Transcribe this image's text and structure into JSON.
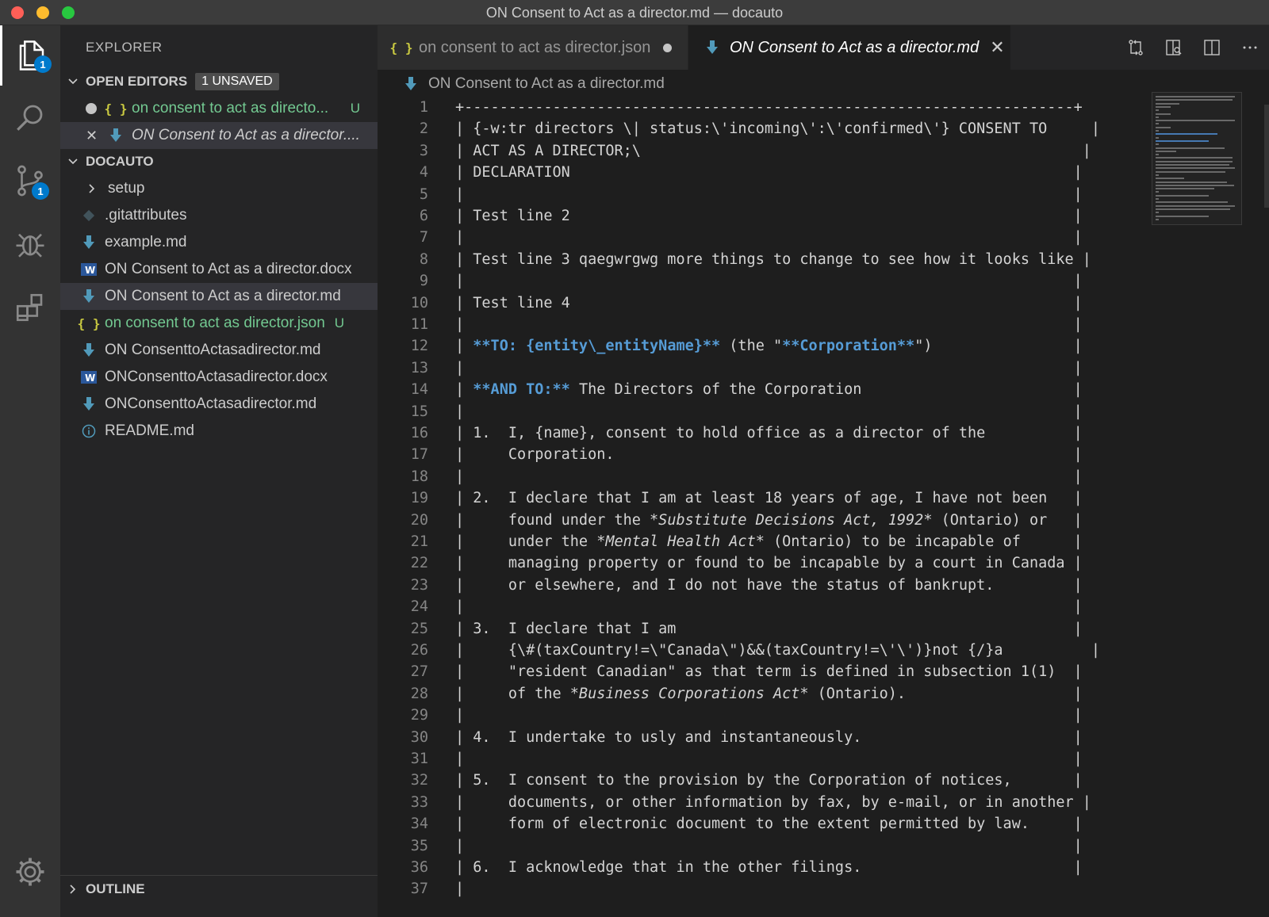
{
  "window": {
    "title": "ON Consent to Act as a director.md — docauto"
  },
  "activity_bar": {
    "explorer_badge": "1",
    "scm_badge": "1",
    "items": [
      "files-icon",
      "search-icon",
      "source-control-icon",
      "debug-icon",
      "extensions-icon",
      "gear-icon"
    ]
  },
  "sidebar": {
    "title": "EXPLORER",
    "open_editors": {
      "label": "OPEN EDITORS",
      "badge": "1 UNSAVED",
      "items": [
        {
          "name": "on consent to act as directo...",
          "status": "U",
          "icon": "json-icon"
        },
        {
          "name": "ON Consent to Act as a director....",
          "icon": "markdown-icon"
        }
      ]
    },
    "folder": {
      "label": "DOCAUTO",
      "items": [
        {
          "name": "setup",
          "icon": "chevron-right-icon"
        },
        {
          "name": ".gitattributes",
          "icon": "git-icon"
        },
        {
          "name": "example.md",
          "icon": "markdown-icon"
        },
        {
          "name": "ON Consent to Act as a director.docx",
          "icon": "word-icon"
        },
        {
          "name": "ON Consent to Act as a director.md",
          "icon": "markdown-icon"
        },
        {
          "name": "on consent to act as director.json",
          "status": "U",
          "icon": "json-icon"
        },
        {
          "name": "ON ConsenttoActasadirector.md",
          "icon": "markdown-icon"
        },
        {
          "name": "ONConsenttoActasadirector.docx",
          "icon": "word-icon"
        },
        {
          "name": "ONConsenttoActasadirector.md",
          "icon": "markdown-icon"
        },
        {
          "name": "README.md",
          "icon": "info-icon"
        }
      ]
    },
    "outline": {
      "label": "OUTLINE"
    }
  },
  "tabs": [
    {
      "label": "on consent to act as director.json",
      "icon_glyph": "{ }"
    },
    {
      "label": "ON Consent to Act as a director.md",
      "close": "✕"
    }
  ],
  "breadcrumb": "ON Consent to Act as a director.md",
  "code_lines": [
    "+---------------------------------------------------------------------+",
    "| {-w:tr directors \\| status:\\'incoming\\':\\'confirmed\\'} CONSENT TO     |",
    "| ACT AS A DIRECTOR;\\                                                  |",
    "| DECLARATION                                                         |",
    "|                                                                     |",
    "| Test line 2                                                         |",
    "|                                                                     |",
    "| Test line 3 qaegwrgwg more things to change to see how it looks like |",
    "|                                                                     |",
    "| Test line 4                                                         |",
    "|                                                                     |",
    "| **TO: {entity\\_entityName}** (the \"**Corporation**\")                |",
    "|                                                                     |",
    "| **AND TO:** The Directors of the Corporation                        |",
    "|                                                                     |",
    "| 1.  I, {name}, consent to hold office as a director of the          |",
    "|     Corporation.                                                    |",
    "|                                                                     |",
    "| 2.  I declare that I am at least 18 years of age, I have not been   |",
    "|     found under the *Substitute Decisions Act, 1992* (Ontario) or   |",
    "|     under the *Mental Health Act* (Ontario) to be incapable of      |",
    "|     managing property or found to be incapable by a court in Canada |",
    "|     or elsewhere, and I do not have the status of bankrupt.         |",
    "|                                                                     |",
    "| 3.  I declare that I am                                             |",
    "|     {\\#(taxCountry!=\\\"Canada\\\")&&(taxCountry!=\\'\\')}not {/}a          |",
    "|     \"resident Canadian\" as that term is defined in subsection 1(1)  |",
    "|     of the *Business Corporations Act* (Ontario).                   |",
    "|                                                                     |",
    "| 4.  I undertake to usly and instantaneously.                        |",
    "|                                                                     |",
    "| 5.  I consent to the provision by the Corporation of notices,       |",
    "|     documents, or other information by fax, by e-mail, or in another |",
    "|     form of electronic document to the extent permitted by law.     |",
    "|                                                                     |",
    "| 6.  I acknowledge that in the other filings.                        |",
    "|"
  ],
  "colors": {
    "accent": "#007acc",
    "untracked": "#73c991",
    "markdown_icon": "#519aba",
    "json_icon": "#cbcb41",
    "bold_markup": "#569cd6"
  }
}
